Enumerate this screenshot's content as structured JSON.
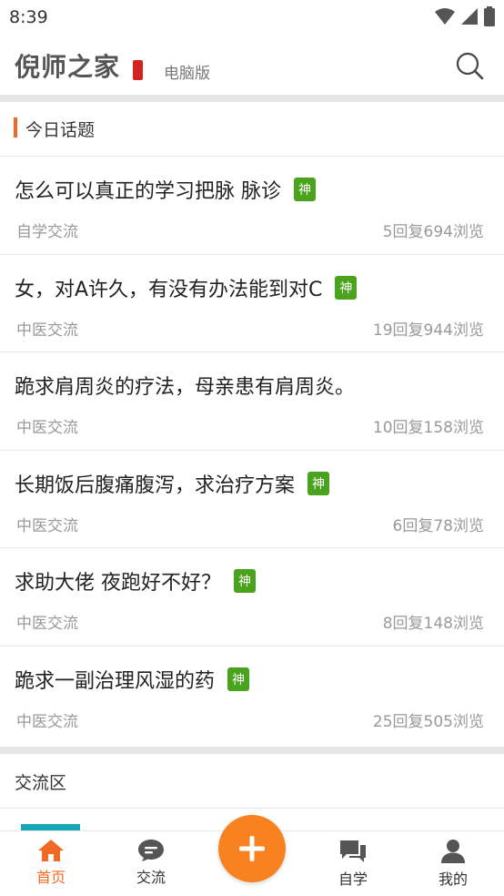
{
  "status_bar": {
    "time": "8:39"
  },
  "header": {
    "logo_text": "倪师之家",
    "pc_version_label": "电脑版"
  },
  "today_section": {
    "title": "今日话题",
    "topics": [
      {
        "title": "怎么可以真正的学习把脉 脉诊",
        "badge": "神",
        "category": "自学交流",
        "stats": "5回复694浏览"
      },
      {
        "title": "女，对A许久，有没有办法能到对C",
        "badge": "神",
        "category": "中医交流",
        "stats": "19回复944浏览"
      },
      {
        "title": "跪求肩周炎的疗法，母亲患有肩周炎。",
        "badge": "",
        "category": "中医交流",
        "stats": "10回复158浏览"
      },
      {
        "title": "长期饭后腹痛腹泻，求治疗方案",
        "badge": "神",
        "category": "中医交流",
        "stats": "6回复78浏览"
      },
      {
        "title": "求助大佬 夜跑好不好？",
        "badge": "神",
        "category": "中医交流",
        "stats": "8回复148浏览"
      },
      {
        "title": "跪求一副治理风湿的药",
        "badge": "神",
        "category": "中医交流",
        "stats": "25回复505浏览"
      }
    ]
  },
  "exchange_section": {
    "title": "交流区"
  },
  "bottom_nav": {
    "home": "首页",
    "exchange": "交流",
    "self_study": "自学",
    "mine": "我的"
  },
  "colors": {
    "accent": "#f26a22",
    "badge": "#4aa31c",
    "fab": "#f7821f"
  }
}
